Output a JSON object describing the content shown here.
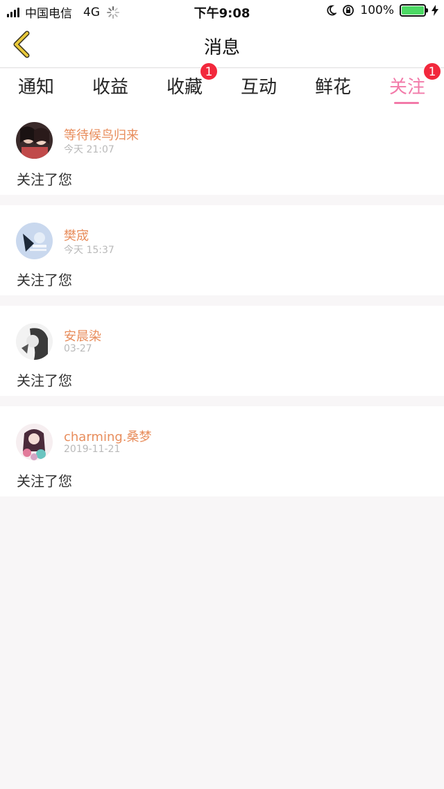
{
  "status_bar": {
    "carrier": "中国电信",
    "network": "4G",
    "time": "下午9:08",
    "battery": "100%",
    "battery_level": 1.0
  },
  "header": {
    "title": "消息",
    "back_icon": "chevron-left-icon"
  },
  "tabs": [
    {
      "label": "通知",
      "badge": ""
    },
    {
      "label": "收益",
      "badge": ""
    },
    {
      "label": "收藏",
      "badge": "1"
    },
    {
      "label": "互动",
      "badge": ""
    },
    {
      "label": "鲜花",
      "badge": ""
    },
    {
      "label": "关注",
      "badge": "1",
      "active": true
    }
  ],
  "colors": {
    "accent": "#f27aa9",
    "name": "#e88d5c",
    "badge": "#f2283c",
    "back_icon": "#d9b52c"
  },
  "messages": [
    {
      "name": "等待候鸟归来",
      "time": "今天 21:07",
      "text": "关注了您"
    },
    {
      "name": "樊宬",
      "time": "今天 15:37",
      "text": "关注了您"
    },
    {
      "name": "安晨染",
      "time": "03-27",
      "text": "关注了您"
    },
    {
      "name": "charming.桑梦",
      "time": "2019-11-21",
      "text": "关注了您"
    }
  ]
}
